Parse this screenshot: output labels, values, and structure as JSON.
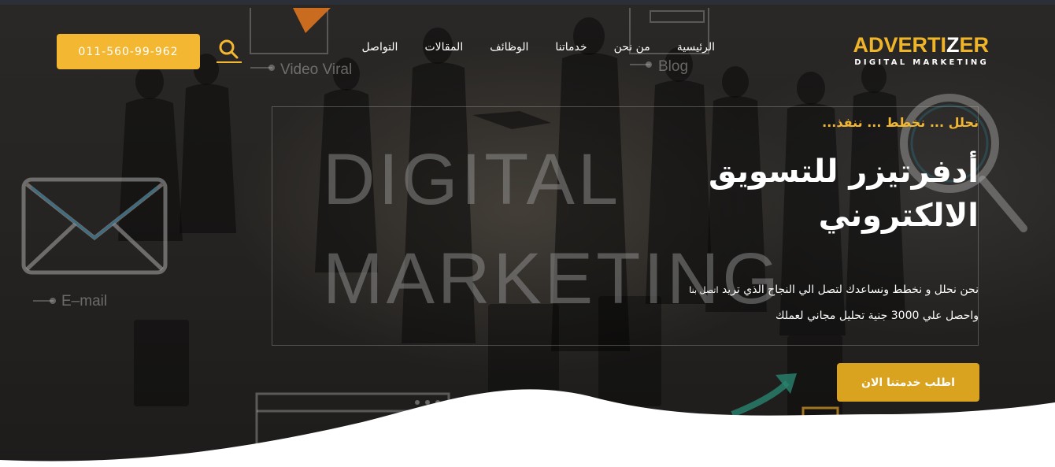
{
  "header": {
    "logo": {
      "main_part1": "ADVERTI",
      "main_part2": "Z",
      "main_part3": "ER",
      "sub": "DIGITAL MARKETING"
    },
    "nav": [
      {
        "label": "الرئيسية"
      },
      {
        "label": "من نحن"
      },
      {
        "label": "خدماتنا"
      },
      {
        "label": "الوظائف"
      },
      {
        "label": "المقالات"
      },
      {
        "label": "التواصل"
      }
    ],
    "search_icon": "search-icon",
    "phone_label": "011-560-99-962"
  },
  "background": {
    "word1": "DIGITAL",
    "word2": "MARKETING",
    "label_video": "Video Viral",
    "label_blog": "Blog",
    "label_email": "E–mail"
  },
  "hero": {
    "tagline": "نحلل ... نخطط ... ننفذ...",
    "headline_line1": "أدفرتيزر للتسويق",
    "headline_line2": "الالكتروني",
    "desc_line1_main": "نحن نحلل و نخطط ونساعدك لتصل الي النجاح الذي تريد",
    "desc_line1_small": "اتصل بنا",
    "desc_line2": "واحصل علي 3000 جنية تحليل مجاني لعملك",
    "cta_label": "اطلب خدمتنا الان"
  },
  "colors": {
    "accent": "#f4b731",
    "cta": "#d9a21f",
    "text": "#ffffff",
    "dark_bg": "#262422"
  }
}
